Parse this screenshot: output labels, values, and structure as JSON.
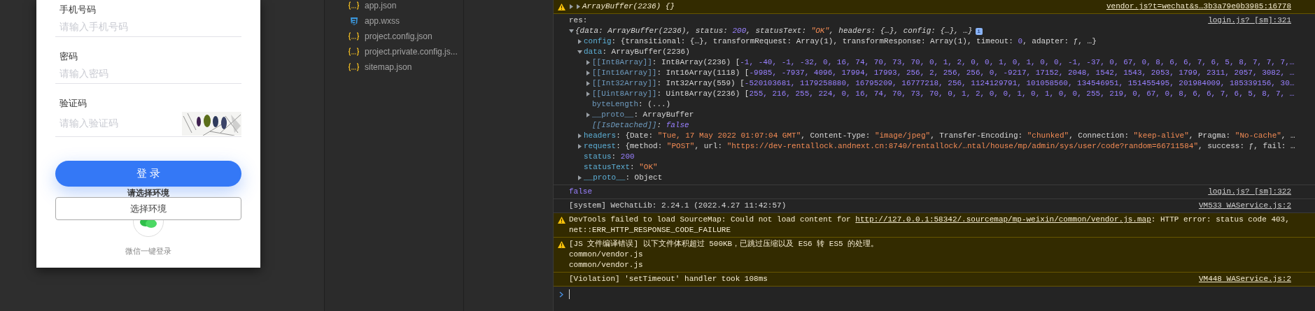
{
  "login_form": {
    "fields": [
      {
        "kind": "text",
        "label": "手机号码",
        "placeholder": "请输入手机号码"
      },
      {
        "kind": "text",
        "label": "密码",
        "placeholder": "请输入密码"
      },
      {
        "kind": "captcha",
        "label": "验证码",
        "placeholder": "请输入验证码"
      }
    ],
    "login_button": "登 录",
    "env_hint": "请选择环境",
    "env_button": "选择环境",
    "wechat_login": "微信一键登录"
  },
  "files": [
    {
      "name": "app.json",
      "kind": "json"
    },
    {
      "name": "app.wxss",
      "kind": "css"
    },
    {
      "name": "project.config.json",
      "kind": "json"
    },
    {
      "name": "project.private.config.js...",
      "kind": "json"
    },
    {
      "name": "sitemap.json",
      "kind": "json"
    }
  ],
  "console": {
    "entries": [
      {
        "kind": "warning",
        "stack_expander": true,
        "source": "vendor.js?t=wechat&s…3b3a79e0b3985:16778",
        "lines": [
          {
            "kind": "collapsed",
            "italic": true,
            "segments": [
              {
                "kind": "plain",
                "text": "ArrayBuffer(2236) {}"
              }
            ]
          }
        ]
      },
      {
        "kind": "log",
        "stack_expander": false,
        "source": "login.js? [sm]:321",
        "lines": [
          {
            "kind": "leaf",
            "italic": false,
            "segments": [
              {
                "kind": "plain",
                "text": "res:"
              }
            ]
          },
          {
            "kind": "expanded",
            "italic": true,
            "segments": [
              {
                "kind": "plain",
                "text": "{data: ArrayBuffer(2236), status: "
              },
              {
                "kind": "number",
                "text": "200"
              },
              {
                "kind": "plain",
                "text": ", statusText: "
              },
              {
                "kind": "string",
                "text": "\"OK\""
              },
              {
                "kind": "plain",
                "text": ", headers: {…}, config: {…}, …}"
              },
              {
                "kind": "badge",
                "text": "i"
              }
            ],
            "children": [
              {
                "kind": "collapsed",
                "italic": false,
                "segments": [
                  {
                    "kind": "key",
                    "text": "config"
                  },
                  {
                    "kind": "plain",
                    "text": ": {transitional: {…}, transformRequest: Array(1), transformResponse: Array(1), timeout: "
                  },
                  {
                    "kind": "number",
                    "text": "0"
                  },
                  {
                    "kind": "plain",
                    "text": ", adapter: ƒ, …}"
                  }
                ]
              },
              {
                "kind": "expanded",
                "italic": false,
                "segments": [
                  {
                    "kind": "key",
                    "text": "data"
                  },
                  {
                    "kind": "plain",
                    "text": ": ArrayBuffer(2236)"
                  }
                ],
                "children": [
                  {
                    "kind": "collapsed",
                    "italic": false,
                    "segments": [
                      {
                        "kind": "internal",
                        "text": "[[Int8Array]]"
                      },
                      {
                        "kind": "plain",
                        "text": ": Int8Array(2236) ["
                      },
                      {
                        "kind": "number",
                        "text": "-1, -40, -1, -32, 0, 16, 74, 70, 73, 70, 0, 1, 2, 0, 0, 1, 0, 1, 0, 0, -1, -37, 0, 67, 0, 8, 6, 6, 7, 6, 5, 8, 7, 7, 7,…"
                      }
                    ]
                  },
                  {
                    "kind": "collapsed",
                    "italic": false,
                    "segments": [
                      {
                        "kind": "internal",
                        "text": "[[Int16Array]]"
                      },
                      {
                        "kind": "plain",
                        "text": ": Int16Array(1118) ["
                      },
                      {
                        "kind": "number",
                        "text": "-9985, -7937, 4096, 17994, 17993, 256, 2, 256, 256, 0, -9217, 17152, 2048, 1542, 1543, 2053, 1799, 2311, 2057, 3082, …"
                      }
                    ]
                  },
                  {
                    "kind": "collapsed",
                    "italic": false,
                    "segments": [
                      {
                        "kind": "internal",
                        "text": "[[Int32Array]]"
                      },
                      {
                        "kind": "plain",
                        "text": ": Int32Array(559) ["
                      },
                      {
                        "kind": "number",
                        "text": "-520103681, 1179258880, 16795209, 16777218, 256, 1124129791, 101058560, 134546951, 151455495, 201984009, 185339156, 30…"
                      }
                    ]
                  },
                  {
                    "kind": "collapsed",
                    "italic": false,
                    "segments": [
                      {
                        "kind": "internal",
                        "text": "[[Uint8Array]]"
                      },
                      {
                        "kind": "plain",
                        "text": ": Uint8Array(2236) ["
                      },
                      {
                        "kind": "number",
                        "text": "255, 216, 255, 224, 0, 16, 74, 70, 73, 70, 0, 1, 2, 0, 0, 1, 0, 1, 0, 0, 255, 219, 0, 67, 0, 8, 6, 6, 7, 6, 5, 8, 7, …"
                      }
                    ]
                  },
                  {
                    "kind": "leaf",
                    "italic": false,
                    "segments": [
                      {
                        "kind": "internal",
                        "text": "byteLength"
                      },
                      {
                        "kind": "plain",
                        "text": ": (...)"
                      }
                    ]
                  },
                  {
                    "kind": "collapsed",
                    "italic": false,
                    "segments": [
                      {
                        "kind": "internal",
                        "text": "__proto__"
                      },
                      {
                        "kind": "plain",
                        "text": ": ArrayBuffer"
                      }
                    ]
                  },
                  {
                    "kind": "leaf",
                    "italic": true,
                    "segments": [
                      {
                        "kind": "internal",
                        "text": "[[IsDetached]]"
                      },
                      {
                        "kind": "plain",
                        "text": ": "
                      },
                      {
                        "kind": "number",
                        "text": "false"
                      }
                    ]
                  }
                ]
              },
              {
                "kind": "collapsed",
                "italic": false,
                "segments": [
                  {
                    "kind": "key",
                    "text": "headers"
                  },
                  {
                    "kind": "plain",
                    "text": ": {Date: "
                  },
                  {
                    "kind": "string",
                    "text": "\"Tue, 17 May 2022 01:07:04 GMT\""
                  },
                  {
                    "kind": "plain",
                    "text": ", Content-Type: "
                  },
                  {
                    "kind": "string",
                    "text": "\"image/jpeg\""
                  },
                  {
                    "kind": "plain",
                    "text": ", Transfer-Encoding: "
                  },
                  {
                    "kind": "string",
                    "text": "\"chunked\""
                  },
                  {
                    "kind": "plain",
                    "text": ", Connection: "
                  },
                  {
                    "kind": "string",
                    "text": "\"keep-alive\""
                  },
                  {
                    "kind": "plain",
                    "text": ", Pragma: "
                  },
                  {
                    "kind": "string",
                    "text": "\"No-cache\""
                  },
                  {
                    "kind": "plain",
                    "text": ", …"
                  }
                ]
              },
              {
                "kind": "collapsed",
                "italic": false,
                "segments": [
                  {
                    "kind": "key",
                    "text": "request"
                  },
                  {
                    "kind": "plain",
                    "text": ": {method: "
                  },
                  {
                    "kind": "string",
                    "text": "\"POST\""
                  },
                  {
                    "kind": "plain",
                    "text": ", url: "
                  },
                  {
                    "kind": "string",
                    "text": "\"https://dev-rentallock.andnext.cn:8740/rentallock/…ntal/house/mp/admin/sys/user/code?random=66711584\""
                  },
                  {
                    "kind": "plain",
                    "text": ", success: ƒ, fail: …"
                  }
                ]
              },
              {
                "kind": "leaf",
                "italic": false,
                "segments": [
                  {
                    "kind": "key",
                    "text": "status"
                  },
                  {
                    "kind": "plain",
                    "text": ": "
                  },
                  {
                    "kind": "number",
                    "text": "200"
                  }
                ]
              },
              {
                "kind": "leaf",
                "italic": false,
                "segments": [
                  {
                    "kind": "key",
                    "text": "statusText"
                  },
                  {
                    "kind": "plain",
                    "text": ": "
                  },
                  {
                    "kind": "string",
                    "text": "\"OK\""
                  }
                ]
              },
              {
                "kind": "collapsed",
                "italic": false,
                "segments": [
                  {
                    "kind": "key",
                    "text": "__proto__"
                  },
                  {
                    "kind": "plain",
                    "text": ": Object"
                  }
                ]
              }
            ]
          }
        ]
      },
      {
        "kind": "log",
        "stack_expander": false,
        "source": "login.js? [sm]:322",
        "lines": [
          {
            "kind": "leaf",
            "italic": false,
            "segments": [
              {
                "kind": "number",
                "text": "false"
              }
            ]
          }
        ]
      },
      {
        "kind": "log",
        "stack_expander": false,
        "source": "VM533 WAService.js:2",
        "lines": [
          {
            "kind": "leaf",
            "italic": false,
            "segments": [
              {
                "kind": "plain",
                "text": "[system] WeChatLib: 2.24.1 (2022.4.27 11:42:57)"
              }
            ]
          }
        ]
      },
      {
        "kind": "warning",
        "stack_expander": false,
        "lines": [
          {
            "kind": "leaf",
            "italic": false,
            "segments": [
              {
                "kind": "plain",
                "text": "DevTools failed to load SourceMap: Could not load content for "
              },
              {
                "kind": "link",
                "text": "http://127.0.0.1:58342/.sourcemap/mp-weixin/common/vendor.js.map"
              },
              {
                "kind": "plain",
                "text": ": HTTP error: status code 403,"
              }
            ]
          },
          {
            "kind": "leaf",
            "italic": false,
            "segments": [
              {
                "kind": "plain",
                "text": "net::ERR_HTTP_RESPONSE_CODE_FAILURE"
              }
            ]
          }
        ]
      },
      {
        "kind": "warning",
        "stack_expander": false,
        "lines": [
          {
            "kind": "leaf",
            "italic": false,
            "segments": [
              {
                "kind": "plain",
                "text": "[JS 文件编译错误] 以下文件体积超过 500KB，已跳过压缩以及 ES6 转 ES5 的处理。"
              }
            ]
          },
          {
            "kind": "leaf",
            "italic": false,
            "segments": [
              {
                "kind": "plain",
                "text": "common/vendor.js"
              }
            ]
          },
          {
            "kind": "leaf",
            "italic": false,
            "segments": [
              {
                "kind": "plain",
                "text": "common/vendor.js"
              }
            ]
          }
        ]
      },
      {
        "kind": "violation",
        "stack_expander": false,
        "source": "VM448 WAService.js:2",
        "lines": [
          {
            "kind": "leaf",
            "italic": false,
            "segments": [
              {
                "kind": "plain",
                "text": "[Violation] 'setTimeout' handler took 108ms"
              }
            ]
          }
        ]
      }
    ]
  }
}
